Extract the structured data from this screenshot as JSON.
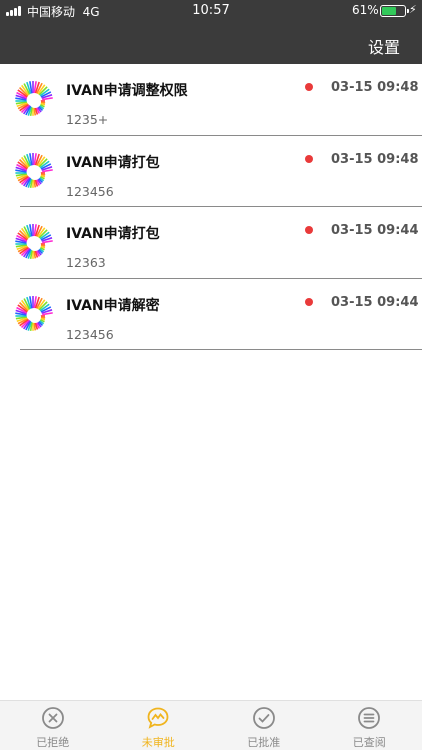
{
  "status": {
    "carrier": "中国移动",
    "network": "4G",
    "time": "10:57",
    "battery_pct": "61%",
    "battery_level": 0.61,
    "battery_color": "#32c85a"
  },
  "header": {
    "settings_label": "设置",
    "background": "#3b3b3b"
  },
  "items": [
    {
      "title": "IVAN申请调整权限",
      "subtitle": "1235+",
      "time": "03-15 09:48",
      "unread": true
    },
    {
      "title": "IVAN申请打包",
      "subtitle": "123456",
      "time": "03-15 09:48",
      "unread": true
    },
    {
      "title": "IVAN申请打包",
      "subtitle": "12363",
      "time": "03-15 09:44",
      "unread": true
    },
    {
      "title": "IVAN申请解密",
      "subtitle": "123456",
      "time": "03-15 09:44",
      "unread": true
    }
  ],
  "tabs": [
    {
      "label": "已拒绝",
      "icon": "x-circle-icon",
      "active": false
    },
    {
      "label": "未审批",
      "icon": "pending-chat-icon",
      "active": true
    },
    {
      "label": "已批准",
      "icon": "check-circle-icon",
      "active": false
    },
    {
      "label": "已查阅",
      "icon": "list-circle-icon",
      "active": false
    }
  ],
  "colors": {
    "active_tab": "#f0b41e",
    "inactive_tab": "#8a8a8a",
    "unread_dot": "#e93a3a"
  }
}
